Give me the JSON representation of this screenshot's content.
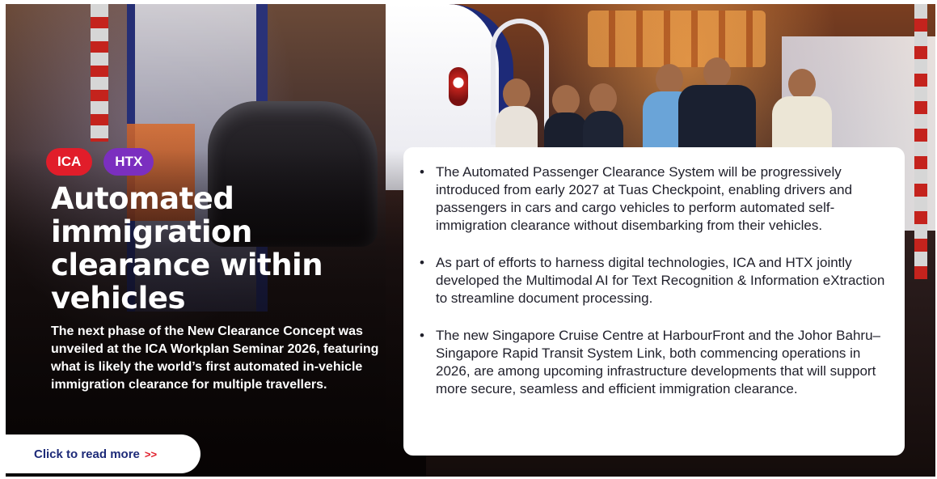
{
  "tags": [
    {
      "label": "ICA",
      "color": "#e11d2a"
    },
    {
      "label": "HTX",
      "color": "#7b2fbf"
    }
  ],
  "headline": "Automated immigration clearance within vehicles",
  "summary": "The next phase of the New Clearance Concept was unveiled at the ICA Workplan Seminar 2026, featuring what is likely the world’s first automated in-vehicle immigration clearance for multiple travellers.",
  "cta": {
    "label": "Click to read more",
    "arrows": ">>"
  },
  "bullets": [
    "The Automated Passenger Clearance System will be progressively introduced from early 2027 at Tuas Checkpoint, enabling drivers and passengers in cars and cargo vehicles to perform automated self-immigration clearance without disembarking from their vehicles.",
    "As part of efforts to harness digital technologies, ICA and HTX jointly developed the Multimodal AI for Text Recognition & Information eXtraction to streamline document processing.",
    "The new Singapore Cruise Centre at HarbourFront and the Johor Bahru–Singapore Rapid Transit System Link, both commencing operations in 2026, are among upcoming infrastructure developments that will support more secure, seamless and efficient immigration clearance."
  ],
  "colors": {
    "brand_navy": "#1d2a78",
    "accent_red": "#e11d2a",
    "accent_purple": "#7b2fbf"
  }
}
